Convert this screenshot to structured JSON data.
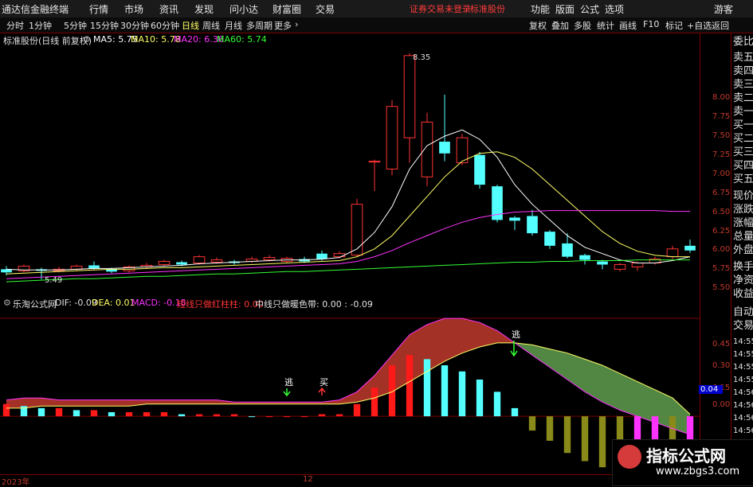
{
  "app": {
    "logo": "通达信金融终端",
    "menus": [
      "行情",
      "市场",
      "资讯",
      "发现",
      "问小达",
      "财富圈",
      "交易"
    ],
    "notice": "证券交易未登录",
    "notice_stock": "标准股份",
    "right_menus": [
      "功能",
      "版面",
      "公式",
      "选项"
    ],
    "guest": "游客"
  },
  "period_tabs": [
    "分时",
    "1分钟",
    "5分钟",
    "15分钟",
    "30分钟",
    "60分钟",
    "日线",
    "周线",
    "月线",
    "多周期",
    "更多"
  ],
  "active_tab": "日线",
  "right_buttons": [
    "复权",
    "叠加",
    "多股",
    "统计",
    "画线",
    "F10",
    "标记",
    "+自选",
    "返回"
  ],
  "main_info": {
    "title": "标准股份(日线 前复权)",
    "ma5": "MA5: 5.75",
    "ma10": "MA10: 5.78",
    "ma20": "MA20: 6.36",
    "ma60": "MA60: 5.74"
  },
  "macd_info": {
    "title": "乐淘公式网",
    "dif": "DIF: -0.09",
    "dea": "DEA: 0.01",
    "macd": "MACD: -0.18",
    "short": "短线只做红柱柱: 0.00",
    "mid": "中线只做暖色带: 0.00 : -0.09"
  },
  "price_axis": [
    "8.00",
    "7.75",
    "7.50",
    "7.25",
    "7.00",
    "6.75",
    "6.50",
    "6.25",
    "6.00",
    "5.75",
    "5.50"
  ],
  "macd_axis": [
    "0.45",
    "0.30",
    "0.15",
    "0.00"
  ],
  "macd_box": "0.04",
  "annotations": {
    "high": "8.35",
    "low": "5.49",
    "escape1": "逃",
    "buy": "买",
    "escape2": "逃"
  },
  "right_panel": [
    "委比",
    "卖五",
    "卖四",
    "卖三",
    "卖二",
    "卖一",
    "买一",
    "买二",
    "买三",
    "买四",
    "买五",
    "现价",
    "涨跌",
    "涨幅",
    "总量",
    "外盘",
    "换手",
    "净资",
    "收益"
  ],
  "right_panel2": [
    "自动",
    "交易",
    "14:55",
    "14:55",
    "14:55",
    "14:55",
    "14:56",
    "14:56",
    "14:56",
    "14:56"
  ],
  "bottom_labels": {
    "year": "2023年",
    "month": "12"
  },
  "watermark": {
    "line1": "指标公式网",
    "line2": "www.zbgs3.com"
  },
  "chart_data": {
    "type": "candlestick",
    "ylim": [
      5.4,
      8.45
    ],
    "candles": [
      {
        "o": 5.62,
        "c": 5.58,
        "h": 5.66,
        "l": 5.54
      },
      {
        "o": 5.6,
        "c": 5.66,
        "h": 5.68,
        "l": 5.58
      },
      {
        "o": 5.62,
        "c": 5.6,
        "h": 5.64,
        "l": 5.49
      },
      {
        "o": 5.6,
        "c": 5.62,
        "h": 5.65,
        "l": 5.58
      },
      {
        "o": 5.62,
        "c": 5.66,
        "h": 5.68,
        "l": 5.6
      },
      {
        "o": 5.67,
        "c": 5.63,
        "h": 5.72,
        "l": 5.61
      },
      {
        "o": 5.62,
        "c": 5.59,
        "h": 5.64,
        "l": 5.57
      },
      {
        "o": 5.6,
        "c": 5.65,
        "h": 5.67,
        "l": 5.58
      },
      {
        "o": 5.65,
        "c": 5.67,
        "h": 5.7,
        "l": 5.63
      },
      {
        "o": 5.68,
        "c": 5.72,
        "h": 5.74,
        "l": 5.66
      },
      {
        "o": 5.71,
        "c": 5.68,
        "h": 5.73,
        "l": 5.66
      },
      {
        "o": 5.7,
        "c": 5.78,
        "h": 5.8,
        "l": 5.68
      },
      {
        "o": 5.71,
        "c": 5.74,
        "h": 5.77,
        "l": 5.69
      },
      {
        "o": 5.72,
        "c": 5.7,
        "h": 5.74,
        "l": 5.68
      },
      {
        "o": 5.72,
        "c": 5.75,
        "h": 5.78,
        "l": 5.7
      },
      {
        "o": 5.74,
        "c": 5.77,
        "h": 5.8,
        "l": 5.72
      },
      {
        "o": 5.72,
        "c": 5.76,
        "h": 5.78,
        "l": 5.7
      },
      {
        "o": 5.75,
        "c": 5.72,
        "h": 5.78,
        "l": 5.7
      },
      {
        "o": 5.82,
        "c": 5.75,
        "h": 5.86,
        "l": 5.73
      },
      {
        "o": 5.78,
        "c": 5.82,
        "h": 5.85,
        "l": 5.76
      },
      {
        "o": 5.8,
        "c": 6.45,
        "h": 6.52,
        "l": 5.78
      },
      {
        "o": 7.0,
        "c": 7.0,
        "h": 7.02,
        "l": 6.62
      },
      {
        "o": 6.9,
        "c": 7.7,
        "h": 7.78,
        "l": 6.82
      },
      {
        "o": 7.3,
        "c": 8.35,
        "h": 8.38,
        "l": 6.98
      },
      {
        "o": 6.8,
        "c": 7.5,
        "h": 7.62,
        "l": 6.68
      },
      {
        "o": 7.25,
        "c": 7.1,
        "h": 7.85,
        "l": 7.0
      },
      {
        "o": 6.98,
        "c": 7.3,
        "h": 7.35,
        "l": 6.95
      },
      {
        "o": 7.08,
        "c": 6.7,
        "h": 7.12,
        "l": 6.65
      },
      {
        "o": 6.68,
        "c": 6.25,
        "h": 6.7,
        "l": 6.22
      },
      {
        "o": 6.28,
        "c": 6.24,
        "h": 6.3,
        "l": 6.12
      },
      {
        "o": 6.3,
        "c": 6.08,
        "h": 6.38,
        "l": 6.05
      },
      {
        "o": 6.1,
        "c": 5.92,
        "h": 6.12,
        "l": 5.88
      },
      {
        "o": 5.95,
        "c": 5.78,
        "h": 6.08,
        "l": 5.76
      },
      {
        "o": 5.8,
        "c": 5.74,
        "h": 5.82,
        "l": 5.68
      },
      {
        "o": 5.72,
        "c": 5.68,
        "h": 5.74,
        "l": 5.62
      },
      {
        "o": 5.62,
        "c": 5.68,
        "h": 5.7,
        "l": 5.59
      },
      {
        "o": 5.65,
        "c": 5.7,
        "h": 5.72,
        "l": 5.6
      },
      {
        "o": 5.7,
        "c": 5.75,
        "h": 5.78,
        "l": 5.68
      },
      {
        "o": 5.78,
        "c": 5.88,
        "h": 5.92,
        "l": 5.75
      },
      {
        "o": 5.92,
        "c": 5.86,
        "h": 6.0,
        "l": 5.83
      }
    ],
    "ma5": [
      5.62,
      5.61,
      5.61,
      5.61,
      5.62,
      5.63,
      5.63,
      5.64,
      5.65,
      5.66,
      5.67,
      5.69,
      5.7,
      5.71,
      5.72,
      5.73,
      5.74,
      5.74,
      5.75,
      5.77,
      5.88,
      6.09,
      6.42,
      6.9,
      7.2,
      7.32,
      7.4,
      7.28,
      7.05,
      6.7,
      6.45,
      6.25,
      6.05,
      5.9,
      5.82,
      5.74,
      5.7,
      5.7,
      5.73,
      5.78
    ],
    "ma10": [
      5.56,
      5.57,
      5.58,
      5.59,
      5.6,
      5.61,
      5.62,
      5.62,
      5.63,
      5.64,
      5.64,
      5.65,
      5.66,
      5.67,
      5.68,
      5.69,
      5.7,
      5.71,
      5.72,
      5.73,
      5.78,
      5.88,
      6.05,
      6.3,
      6.55,
      6.8,
      7.0,
      7.1,
      7.12,
      7.05,
      6.9,
      6.7,
      6.5,
      6.3,
      6.1,
      5.95,
      5.85,
      5.8,
      5.78,
      5.78
    ],
    "ma20": [
      5.5,
      5.51,
      5.52,
      5.53,
      5.54,
      5.55,
      5.56,
      5.57,
      5.58,
      5.59,
      5.6,
      5.61,
      5.62,
      5.63,
      5.64,
      5.65,
      5.66,
      5.67,
      5.68,
      5.69,
      5.72,
      5.78,
      5.86,
      5.96,
      6.05,
      6.14,
      6.22,
      6.28,
      6.32,
      6.35,
      6.36,
      6.37,
      6.37,
      6.37,
      6.37,
      6.37,
      6.37,
      6.37,
      6.36,
      6.36
    ],
    "ma60": [
      5.46,
      5.47,
      5.48,
      5.49,
      5.5,
      5.5,
      5.51,
      5.52,
      5.53,
      5.53,
      5.54,
      5.55,
      5.56,
      5.56,
      5.57,
      5.58,
      5.59,
      5.59,
      5.6,
      5.61,
      5.62,
      5.63,
      5.64,
      5.65,
      5.66,
      5.67,
      5.68,
      5.69,
      5.7,
      5.71,
      5.71,
      5.72,
      5.72,
      5.73,
      5.73,
      5.73,
      5.74,
      5.74,
      5.74,
      5.74
    ],
    "macd_ylim": [
      -0.3,
      0.5
    ],
    "macd_bars": [
      0.06,
      0.05,
      0.04,
      0.04,
      0.03,
      0.03,
      0.02,
      0.02,
      0.02,
      0.02,
      0.01,
      0.01,
      0.01,
      0.01,
      0.0,
      0.0,
      0.0,
      0.0,
      0.01,
      0.01,
      0.06,
      0.14,
      0.25,
      0.3,
      0.28,
      0.25,
      0.22,
      0.18,
      0.12,
      0.04,
      -0.07,
      -0.12,
      -0.18,
      -0.22,
      -0.25,
      -0.25,
      -0.22,
      -0.2,
      -0.2,
      -0.18
    ],
    "dif": [
      0.08,
      0.09,
      0.09,
      0.08,
      0.08,
      0.08,
      0.08,
      0.08,
      0.08,
      0.08,
      0.08,
      0.08,
      0.08,
      0.07,
      0.07,
      0.07,
      0.07,
      0.07,
      0.07,
      0.08,
      0.12,
      0.2,
      0.3,
      0.4,
      0.45,
      0.48,
      0.48,
      0.46,
      0.42,
      0.36,
      0.3,
      0.24,
      0.18,
      0.12,
      0.07,
      0.03,
      0.0,
      -0.03,
      -0.06,
      -0.09
    ],
    "dea": [
      0.04,
      0.04,
      0.05,
      0.05,
      0.05,
      0.05,
      0.05,
      0.05,
      0.06,
      0.06,
      0.06,
      0.06,
      0.06,
      0.06,
      0.06,
      0.06,
      0.06,
      0.06,
      0.06,
      0.06,
      0.07,
      0.09,
      0.12,
      0.17,
      0.22,
      0.27,
      0.31,
      0.34,
      0.36,
      0.36,
      0.35,
      0.33,
      0.31,
      0.28,
      0.25,
      0.21,
      0.17,
      0.13,
      0.09,
      0.01
    ]
  }
}
